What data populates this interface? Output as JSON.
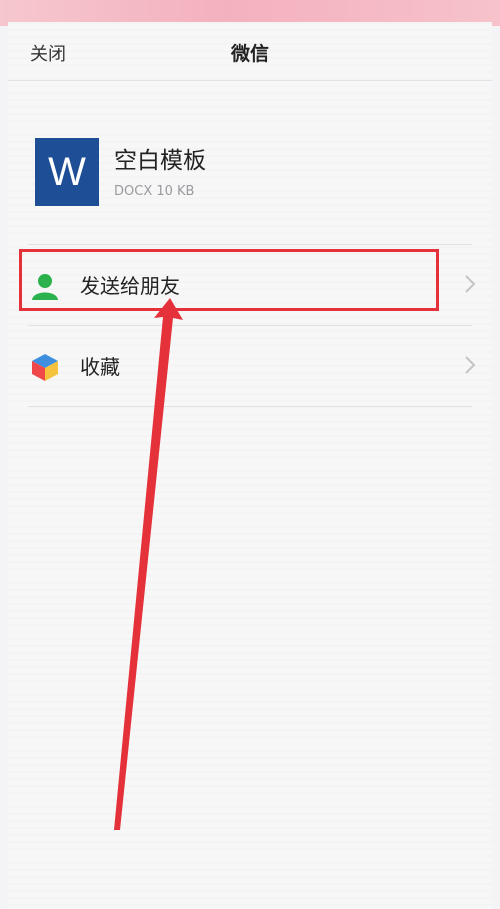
{
  "nav": {
    "close_label": "关闭",
    "title": "微信"
  },
  "file": {
    "icon_letter": "W",
    "name": "空白模板",
    "meta": "DOCX 10 KB"
  },
  "actions": [
    {
      "label": "发送给朋友",
      "icon": "person-icon"
    },
    {
      "label": "收藏",
      "icon": "cube-icon"
    }
  ],
  "colors": {
    "word_blue": "#1e4f96",
    "highlight_red": "#e5323a",
    "person_green": "#2bb24c"
  }
}
